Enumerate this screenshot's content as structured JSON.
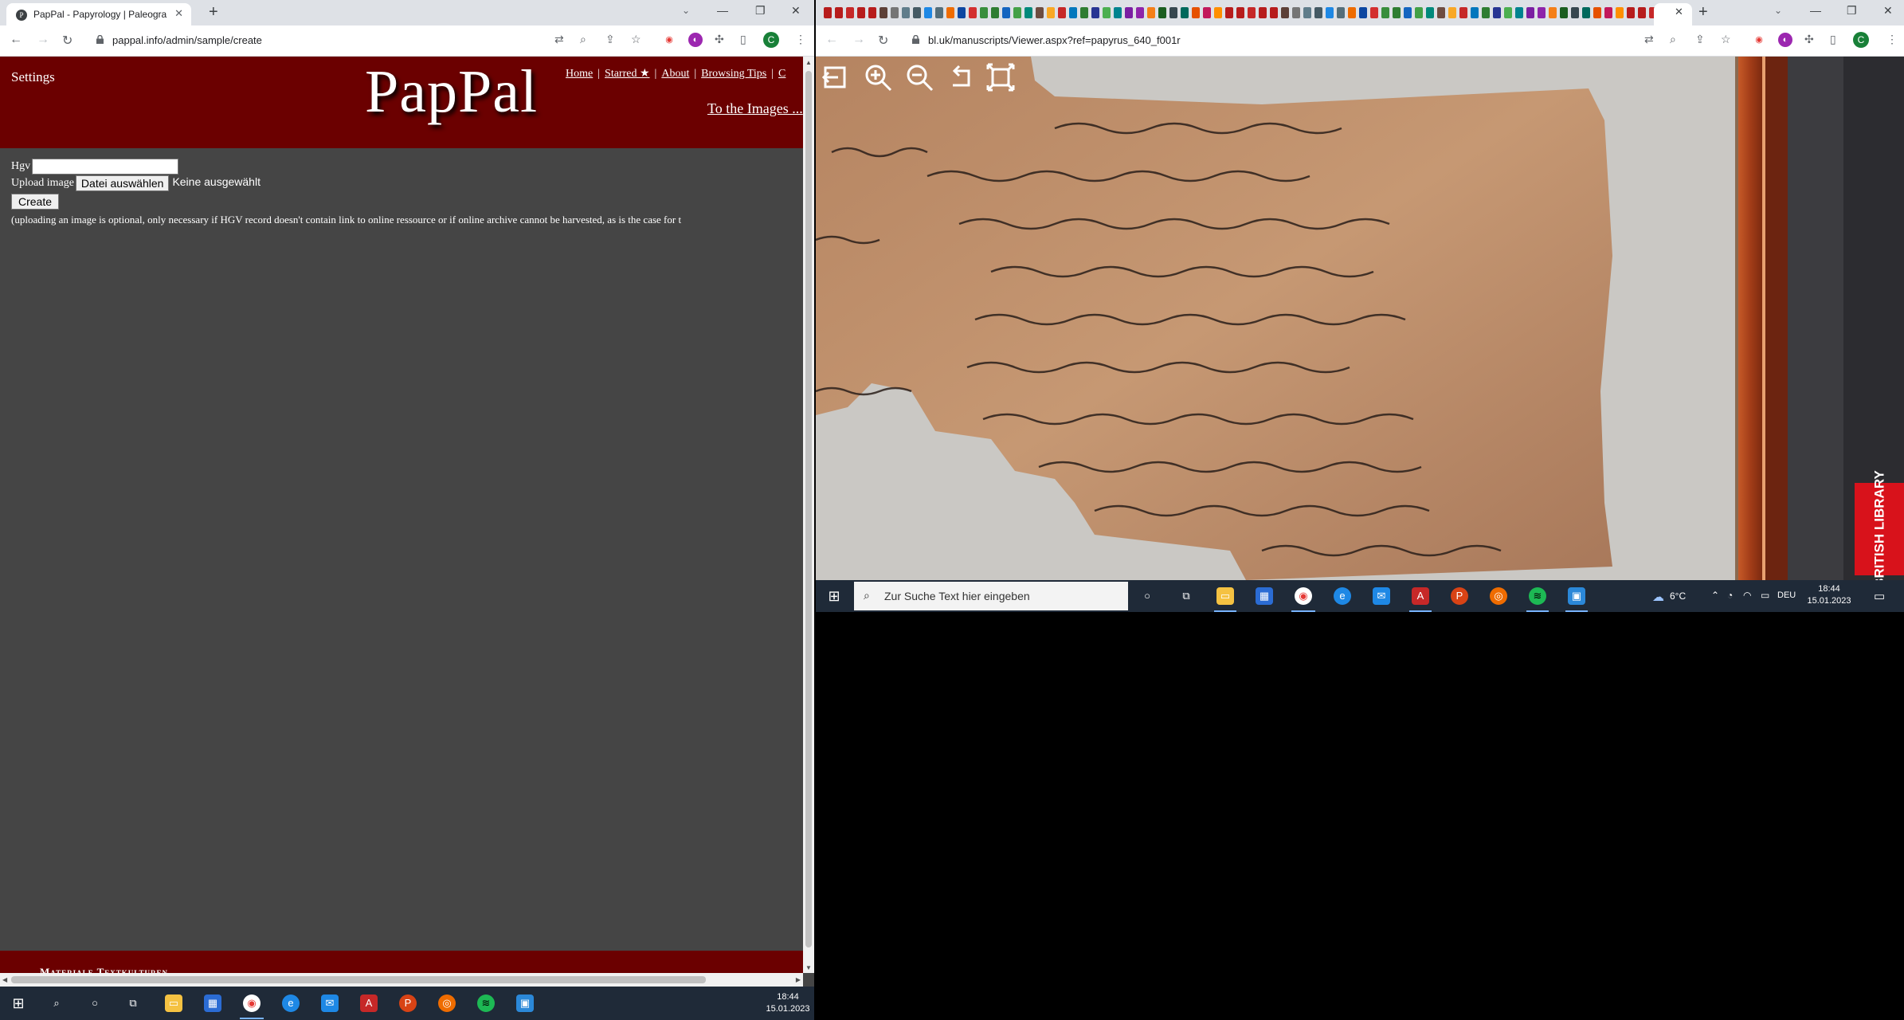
{
  "left_window": {
    "tab_title": "PapPal - Papyrology | Paleograph",
    "tab_favicon": "pappal-favicon",
    "url": "pappal.info/admin/sample/create",
    "profile_initial": "C",
    "page": {
      "settings_label": "Settings",
      "logo": "PapPal",
      "nav": [
        "Home",
        "Starred ★",
        "About",
        "Browsing Tips",
        "C"
      ],
      "to_images": "To the Images ...",
      "hgv_label": "Hgv",
      "hgv_value": "",
      "upload_label": "Upload image",
      "file_button": "Datei auswählen",
      "file_status": "Keine ausgewählt",
      "create_button": "Create",
      "note": "(uploading an image is optional, only necessary if HGV record doesn't contain link to online ressource or if online archive cannot be harvested, as is the case for t",
      "footer_text": "Materiale Textkulturen"
    },
    "taskbar": {
      "time": "18:44",
      "date": "15.01.2023"
    }
  },
  "right_window": {
    "url": "bl.uk/manuscripts/Viewer.aspx?ref=papyrus_640_f001r",
    "profile_initial": "C",
    "viewer_tools": [
      "exit-icon",
      "zoom-in-icon",
      "zoom-out-icon",
      "rotate-icon",
      "fullscreen-icon"
    ],
    "brand_logo": "BRITISH LIBRARY",
    "taskbar": {
      "search_placeholder": "Zur Suche Text hier eingeben",
      "weather": "6°C",
      "language": "DEU",
      "time": "18:44",
      "date": "15.01.2023"
    }
  },
  "colors": {
    "banner": "#6b0000",
    "page_bg": "#454545",
    "taskbar": "#1f2a38",
    "bl_red": "#d8121b"
  }
}
